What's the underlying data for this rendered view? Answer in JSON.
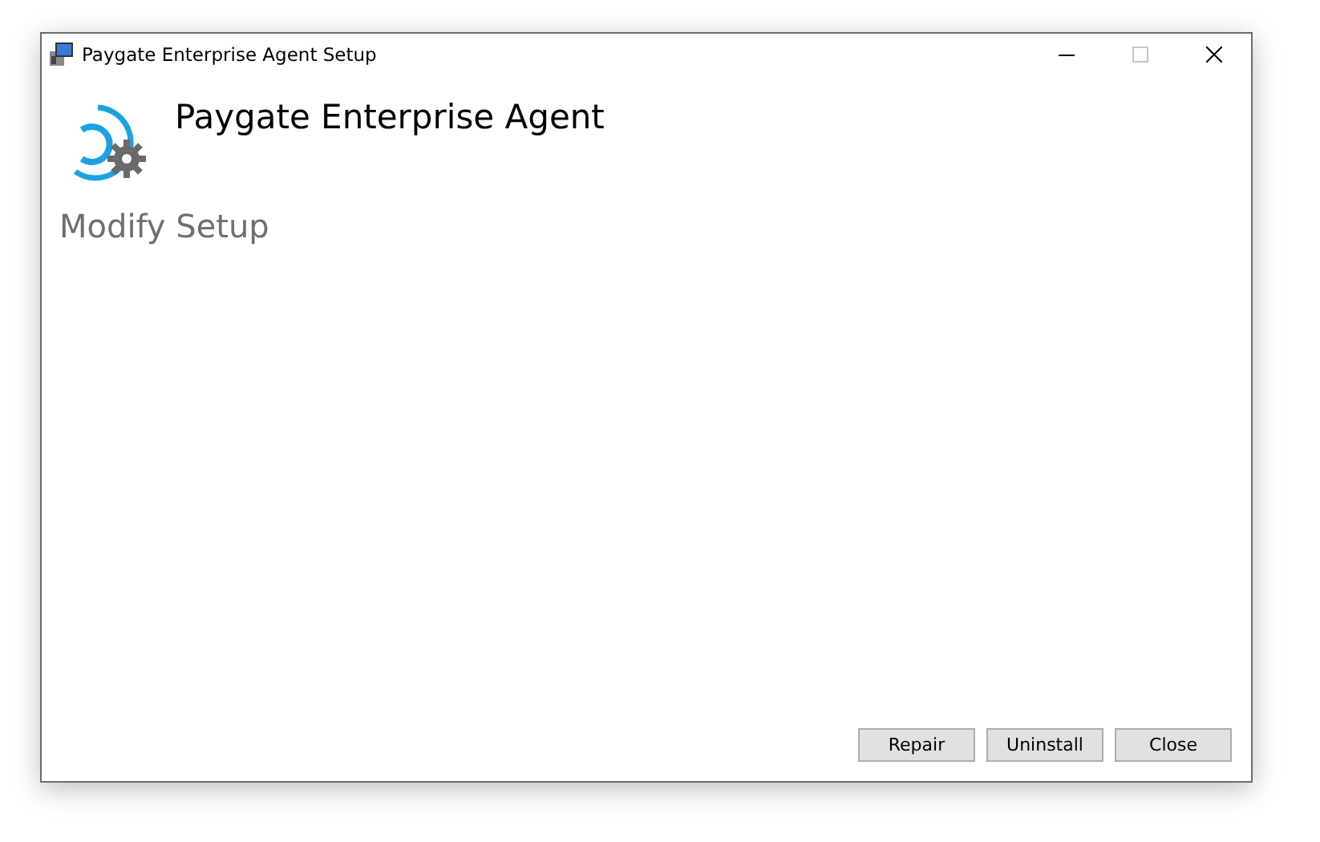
{
  "window": {
    "title": "Paygate Enterprise Agent Setup",
    "maximize_disabled": true
  },
  "product": {
    "name": "Paygate Enterprise Agent"
  },
  "heading": "Modify Setup",
  "buttons": [
    {
      "label": "Repair"
    },
    {
      "label": "Uninstall"
    },
    {
      "label": "Close"
    }
  ]
}
